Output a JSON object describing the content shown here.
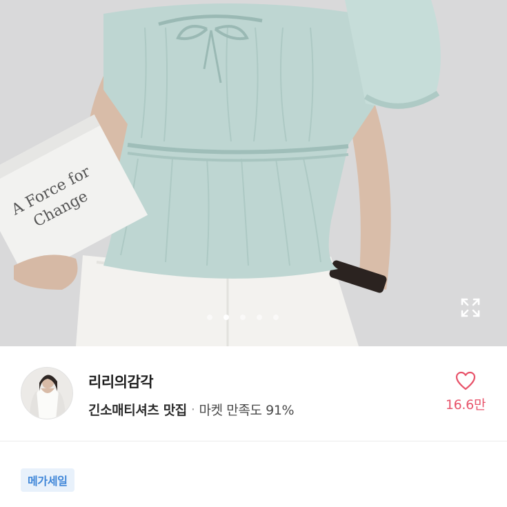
{
  "product_image": {
    "book_text_line1": "A Force for",
    "book_text_line2": "Change",
    "carousel_count": 5,
    "carousel_active_index": 1
  },
  "seller": {
    "name": "리리의감각",
    "tagline": "긴소매티셔츠 맛집",
    "separator": "·",
    "satisfaction": "마켓 만족도 91%",
    "like_count": "16.6만"
  },
  "badge": {
    "label": "메가세일"
  },
  "colors": {
    "accent_pink": "#e8536a",
    "badge_blue": "#3f86d8",
    "badge_bg": "#e8f1fb"
  }
}
